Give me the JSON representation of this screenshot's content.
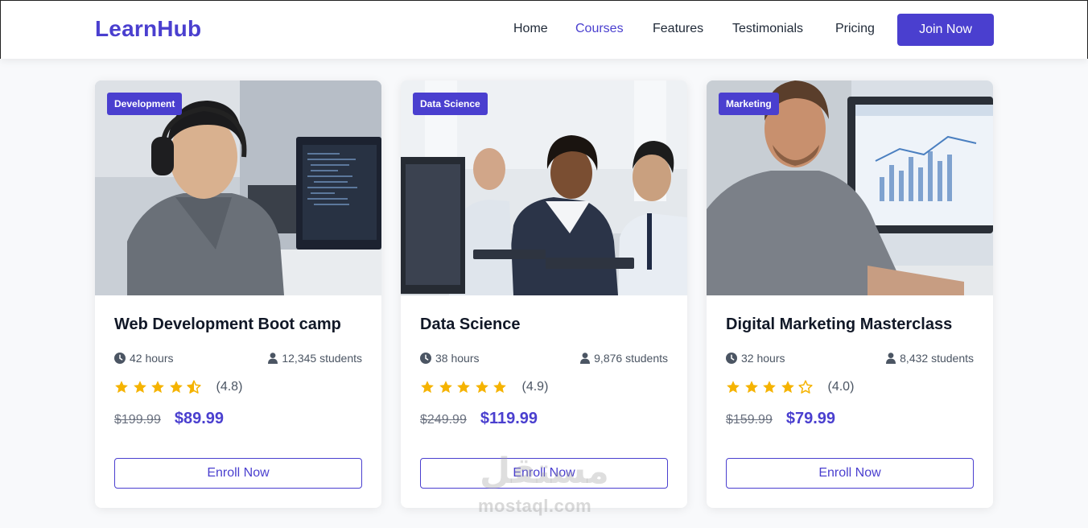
{
  "brand": {
    "name": "LearnHub",
    "accent": "#4a3fcf"
  },
  "nav": {
    "links": [
      {
        "label": "Home",
        "active": false
      },
      {
        "label": "Courses",
        "active": true
      },
      {
        "label": "Features",
        "active": false
      },
      {
        "label": "Testimonials",
        "active": false
      },
      {
        "label": "Pricing",
        "active": false
      }
    ],
    "cta_label": "Join Now"
  },
  "courses": [
    {
      "category": "Development",
      "title": "Web Development Boot camp",
      "hours": "42 hours",
      "students": "12,345 students",
      "rating": 4.8,
      "rating_label": "(4.8)",
      "old_price": "$199.99",
      "price": "$89.99",
      "enroll_label": "Enroll Now"
    },
    {
      "category": "Data Science",
      "title": "Data Science",
      "hours": "38 hours",
      "students": "9,876 students",
      "rating": 4.9,
      "rating_label": "(4.9)",
      "old_price": "$249.99",
      "price": "$119.99",
      "enroll_label": "Enroll Now"
    },
    {
      "category": "Marketing",
      "title": "Digital Marketing Masterclass",
      "hours": "32 hours",
      "students": "8,432 students",
      "rating": 4.0,
      "rating_label": "(4.0)",
      "old_price": "$159.99",
      "price": "$79.99",
      "enroll_label": "Enroll Now"
    }
  ],
  "icons": {
    "hours": "clock-icon",
    "students": "user-icon",
    "rating": "star-icon"
  },
  "colors": {
    "star": "#f5b300",
    "muted_text": "#4b5563"
  },
  "watermark": {
    "arabic": "مستقل",
    "latin": "mostaql.com"
  }
}
